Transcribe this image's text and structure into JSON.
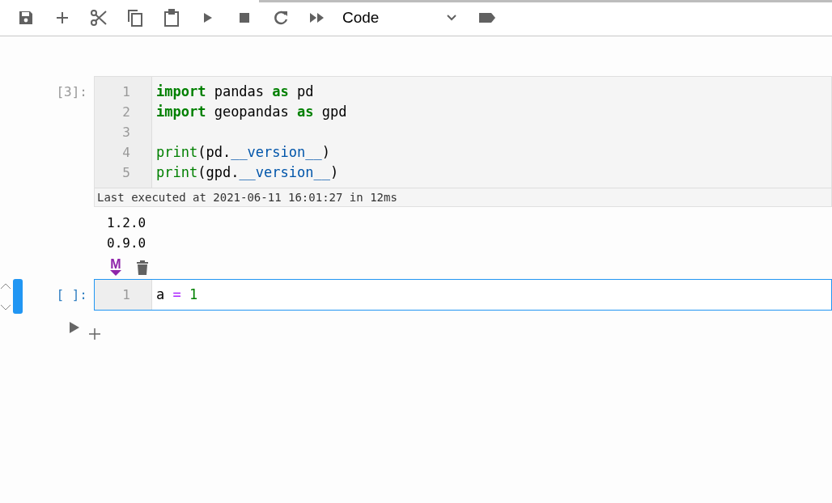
{
  "toolbar": {
    "cell_type": "Code"
  },
  "cells": [
    {
      "prompt": "[3]:",
      "selected": false,
      "lines": [
        {
          "number": "1",
          "tokens": [
            {
              "text": "import",
              "kind": "keyword"
            },
            {
              "text": " pandas ",
              "kind": "plain"
            },
            {
              "text": "as",
              "kind": "keyword"
            },
            {
              "text": " pd",
              "kind": "plain"
            }
          ]
        },
        {
          "number": "2",
          "tokens": [
            {
              "text": "import",
              "kind": "keyword"
            },
            {
              "text": " geopandas ",
              "kind": "plain"
            },
            {
              "text": "as",
              "kind": "keyword"
            },
            {
              "text": " gpd",
              "kind": "plain"
            }
          ]
        },
        {
          "number": "3"
        },
        {
          "number": "4",
          "tokens": [
            {
              "text": "print",
              "kind": "builtin"
            },
            {
              "text": "(pd.",
              "kind": "plain"
            },
            {
              "text": "__version__",
              "kind": "variable"
            },
            {
              "text": ")",
              "kind": "plain"
            }
          ]
        },
        {
          "number": "5",
          "tokens": [
            {
              "text": "print",
              "kind": "builtin"
            },
            {
              "text": "(gpd.",
              "kind": "plain"
            },
            {
              "text": "__version__",
              "kind": "variable"
            },
            {
              "text": ")",
              "kind": "plain"
            }
          ]
        }
      ],
      "exec_info": "Last executed at 2021-06-11 16:01:27 in 12ms",
      "outputs": [
        "1.2.0",
        "0.9.0"
      ],
      "tools": {
        "markdown_label": "M"
      }
    },
    {
      "prompt": "[ ]:",
      "selected": true,
      "lines": [
        {
          "number": "1",
          "tokens": [
            {
              "text": "a ",
              "kind": "plain"
            },
            {
              "text": "= ",
              "kind": "operator"
            },
            {
              "text": "1",
              "kind": "number"
            }
          ]
        }
      ]
    }
  ]
}
